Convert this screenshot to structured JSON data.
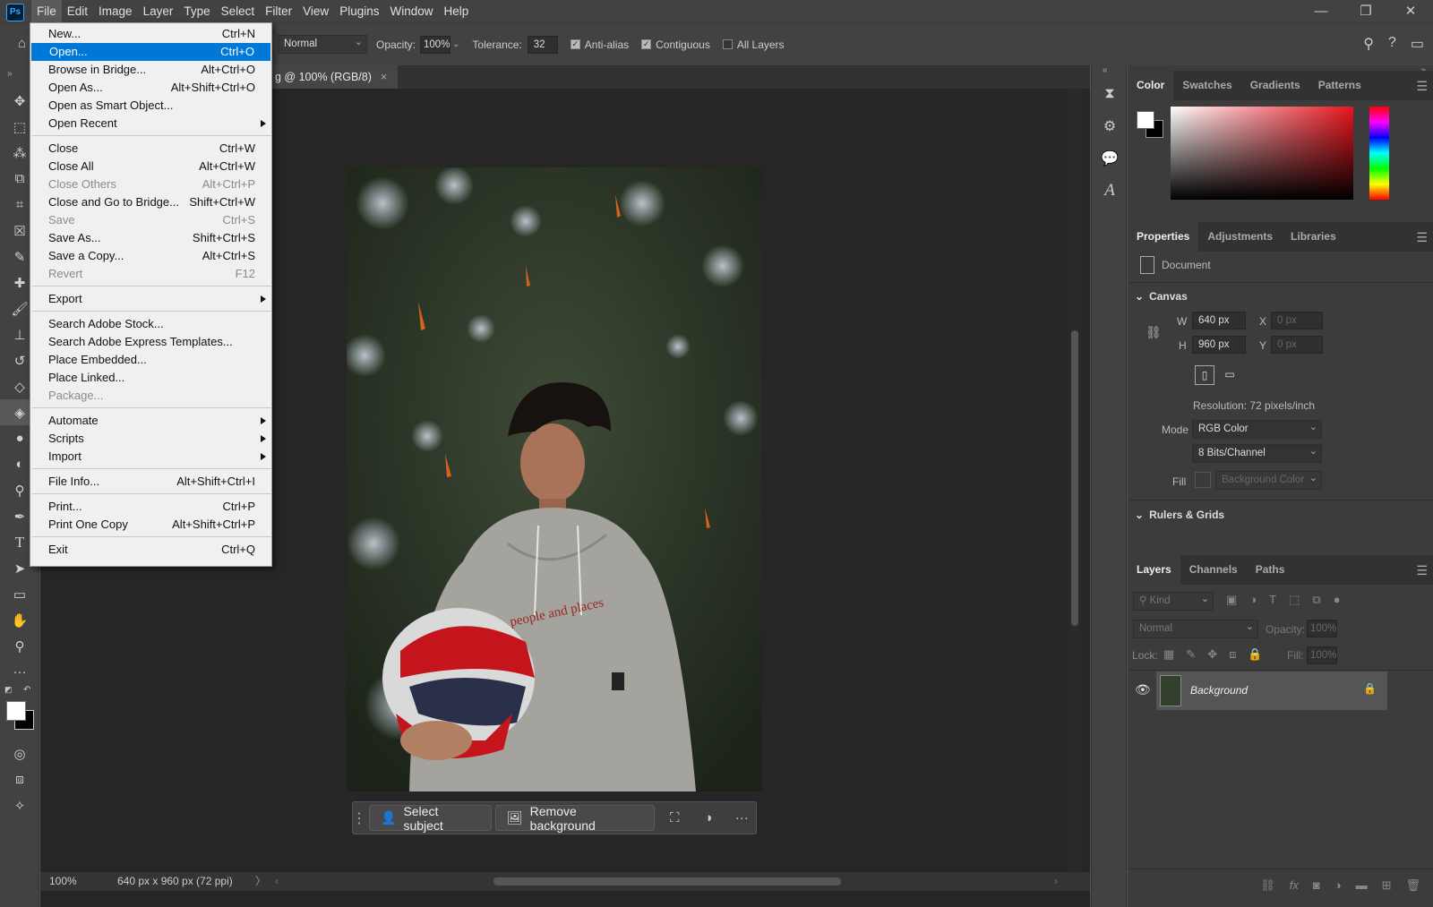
{
  "menubar": {
    "logo": "Ps",
    "items": [
      "File",
      "Edit",
      "Image",
      "Layer",
      "Type",
      "Select",
      "Filter",
      "View",
      "Plugins",
      "Window",
      "Help"
    ],
    "window_controls": [
      "—",
      "❐",
      "✕"
    ]
  },
  "options": {
    "mode": "Normal",
    "opacity_label": "Opacity:",
    "opacity": "100%",
    "tolerance_label": "Tolerance:",
    "tolerance": "32",
    "anti_alias": "Anti-alias",
    "contiguous": "Contiguous",
    "all_layers": "All Layers"
  },
  "document": {
    "tab_title": "g @ 100% (RGB/8)",
    "tab_close": "×",
    "zoom": "100%",
    "status": "640 px x 960 px (72 ppi)",
    "status_arrow": "〉"
  },
  "context_bar": {
    "select_subject": "Select subject",
    "remove_background": "Remove background",
    "more": "···"
  },
  "file_menu": [
    {
      "label": "New...",
      "shortcut": "Ctrl+N"
    },
    {
      "label": "Open...",
      "shortcut": "Ctrl+O",
      "highlight": true
    },
    {
      "label": "Browse in Bridge...",
      "shortcut": "Alt+Ctrl+O"
    },
    {
      "label": "Open As...",
      "shortcut": "Alt+Shift+Ctrl+O"
    },
    {
      "label": "Open as Smart Object...",
      "shortcut": ""
    },
    {
      "label": "Open Recent",
      "shortcut": "",
      "submenu": true
    },
    {
      "sep": true
    },
    {
      "label": "Close",
      "shortcut": "Ctrl+W"
    },
    {
      "label": "Close All",
      "shortcut": "Alt+Ctrl+W"
    },
    {
      "label": "Close Others",
      "shortcut": "Alt+Ctrl+P",
      "disabled": true
    },
    {
      "label": "Close and Go to Bridge...",
      "shortcut": "Shift+Ctrl+W"
    },
    {
      "label": "Save",
      "shortcut": "Ctrl+S",
      "disabled": true
    },
    {
      "label": "Save As...",
      "shortcut": "Shift+Ctrl+S"
    },
    {
      "label": "Save a Copy...",
      "shortcut": "Alt+Ctrl+S"
    },
    {
      "label": "Revert",
      "shortcut": "F12",
      "disabled": true
    },
    {
      "sep": true
    },
    {
      "label": "Export",
      "shortcut": "",
      "submenu": true
    },
    {
      "sep": true
    },
    {
      "label": "Search Adobe Stock...",
      "shortcut": ""
    },
    {
      "label": "Search Adobe Express Templates...",
      "shortcut": ""
    },
    {
      "label": "Place Embedded...",
      "shortcut": ""
    },
    {
      "label": "Place Linked...",
      "shortcut": ""
    },
    {
      "label": "Package...",
      "shortcut": "",
      "disabled": true
    },
    {
      "sep": true
    },
    {
      "label": "Automate",
      "shortcut": "",
      "submenu": true
    },
    {
      "label": "Scripts",
      "shortcut": "",
      "submenu": true
    },
    {
      "label": "Import",
      "shortcut": "",
      "submenu": true
    },
    {
      "sep": true
    },
    {
      "label": "File Info...",
      "shortcut": "Alt+Shift+Ctrl+I"
    },
    {
      "sep": true
    },
    {
      "label": "Print...",
      "shortcut": "Ctrl+P"
    },
    {
      "label": "Print One Copy",
      "shortcut": "Alt+Shift+Ctrl+P"
    },
    {
      "sep": true
    },
    {
      "label": "Exit",
      "shortcut": "Ctrl+Q"
    }
  ],
  "color_panel": {
    "tabs": [
      "Color",
      "Swatches",
      "Gradients",
      "Patterns"
    ],
    "fg": "#ffffff",
    "bg": "#000000",
    "hue_color": "#e8141e"
  },
  "properties_panel": {
    "tabs": [
      "Properties",
      "Adjustments",
      "Libraries"
    ],
    "doc_label": "Document",
    "canvas_section": "Canvas",
    "w_label": "W",
    "w": "640 px",
    "h_label": "H",
    "h": "960 px",
    "x_label": "X",
    "x": "0 px",
    "y_label": "Y",
    "y": "0 px",
    "resolution": "Resolution: 72 pixels/inch",
    "mode_label": "Mode",
    "mode": "RGB Color",
    "bits": "8 Bits/Channel",
    "fill_label": "Fill",
    "fill": "Background Color",
    "rulers_section": "Rulers & Grids"
  },
  "layers_panel": {
    "tabs": [
      "Layers",
      "Channels",
      "Paths"
    ],
    "kind": "Kind",
    "blend": "Normal",
    "opacity_label": "Opacity:",
    "opacity": "100%",
    "lock_label": "Lock:",
    "fill_label": "Fill:",
    "fill": "100%",
    "layer_name": "Background"
  },
  "photo": {
    "text": "people and places"
  }
}
